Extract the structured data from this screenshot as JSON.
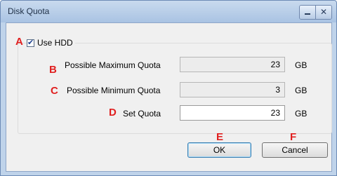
{
  "window": {
    "title": "Disk Quota"
  },
  "use_hdd": {
    "label": "Use HDD",
    "checked": true
  },
  "markers": {
    "a": "A",
    "b": "B",
    "c": "C",
    "d": "D",
    "e": "E",
    "f": "F"
  },
  "fields": {
    "max_quota": {
      "label": "Possible Maximum Quota",
      "value": "23",
      "unit": "GB"
    },
    "min_quota": {
      "label": "Possible Minimum Quota",
      "value": "3",
      "unit": "GB"
    },
    "set_quota": {
      "label": "Set Quota",
      "value": "23",
      "unit": "GB"
    }
  },
  "buttons": {
    "ok": "OK",
    "cancel": "Cancel"
  },
  "colors": {
    "marker": "#e02020",
    "titlebar": "#b7cde8",
    "dialog_bg": "#f0f0f0"
  }
}
